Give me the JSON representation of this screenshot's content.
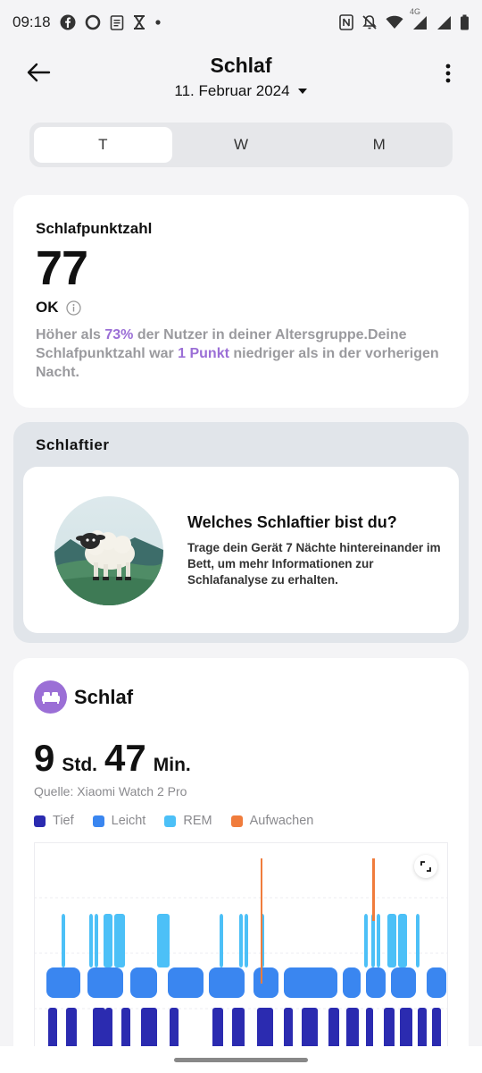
{
  "status_bar": {
    "time": "09:18",
    "left_icons": [
      "facebook-icon",
      "circle-app-icon",
      "clipboard-icon",
      "hourglass-icon",
      "dot-icon"
    ],
    "right_icons": [
      "nfc-icon",
      "bell-off-icon",
      "wifi-icon",
      "signal-4g-icon",
      "signal-icon",
      "battery-icon"
    ],
    "network_label": "4G"
  },
  "header": {
    "title": "Schlaf",
    "date": "11. Februar 2024"
  },
  "tabs": [
    {
      "label": "T",
      "active": true
    },
    {
      "label": "W",
      "active": false
    },
    {
      "label": "M",
      "active": false
    }
  ],
  "score_card": {
    "label": "Schlafpunktzahl",
    "value": "77",
    "rating": "OK",
    "desc_part1": "Höher als ",
    "desc_hl1": "73%",
    "desc_part2": " der Nutzer in deiner Altersgruppe.Deine Schlafpunktzahl war ",
    "desc_hl2": "1 Punkt",
    "desc_part3": " niedriger als in der vorherigen Nacht."
  },
  "animal_card": {
    "title": "Schlaftier",
    "question": "Welches Schlaftier bist du?",
    "description": "Trage dein Gerät 7 Nächte hintereinander im Bett, um mehr Informationen zur Schlafanalyse zu erhalten."
  },
  "sleep_card": {
    "title": "Schlaf",
    "hours": "9",
    "hours_unit": "Std.",
    "minutes": "47",
    "minutes_unit": "Min.",
    "source": "Quelle: Xiaomi Watch 2 Pro",
    "legend": [
      {
        "label": "Tief",
        "color": "#2b2bb0"
      },
      {
        "label": "Leicht",
        "color": "#3a86f0"
      },
      {
        "label": "REM",
        "color": "#4cc0f7"
      },
      {
        "label": "Aufwachen",
        "color": "#f07c3c"
      }
    ]
  },
  "colors": {
    "accent": "#9b6fd6",
    "deep": "#2b2bb0",
    "light": "#3a86f0",
    "rem": "#4cc0f7",
    "awake": "#f07c3c"
  }
}
